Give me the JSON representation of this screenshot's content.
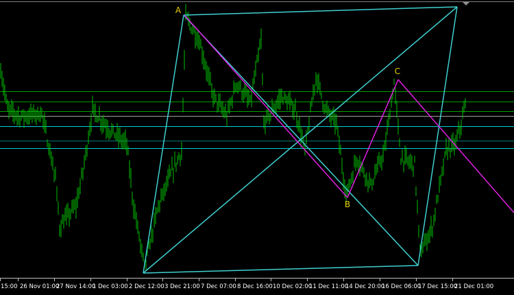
{
  "chart_data": {
    "type": "bar",
    "style": "ohlc-bars",
    "title": "",
    "x_tick_labels": [
      "15:00",
      "26 Nov 01:00",
      "27 Nov 14:00",
      "1 Dec 03:00",
      "2 Dec 12:00",
      "3 Dec 21:00",
      "7 Dec 07:00",
      "8 Dec 16:00",
      "10 Dec 02:00",
      "11 Dec 11:00",
      "14 Dec 20:00",
      "16 Dec 06:00",
      "17 Dec 15:00",
      "21 Dec 01:00"
    ],
    "price_path": [
      {
        "bar": 0,
        "level": 305
      },
      {
        "bar": 5,
        "level": 245
      },
      {
        "bar": 15,
        "level": 235
      },
      {
        "bar": 30,
        "level": 240
      },
      {
        "bar": 40,
        "level": 145
      },
      {
        "bar": 43,
        "level": 75
      },
      {
        "bar": 55,
        "level": 105
      },
      {
        "bar": 60,
        "level": 155
      },
      {
        "bar": 67,
        "level": 245
      },
      {
        "bar": 80,
        "level": 215
      },
      {
        "bar": 92,
        "level": 195
      },
      {
        "bar": 97,
        "level": 105
      },
      {
        "bar": 105,
        "level": 15
      },
      {
        "bar": 115,
        "level": 105
      },
      {
        "bar": 125,
        "level": 155
      },
      {
        "bar": 132,
        "level": 185
      },
      {
        "bar": 135,
        "level": 380
      },
      {
        "bar": 145,
        "level": 345
      },
      {
        "bar": 155,
        "level": 265
      },
      {
        "bar": 165,
        "level": 235
      },
      {
        "bar": 172,
        "level": 285
      },
      {
        "bar": 182,
        "level": 255
      },
      {
        "bar": 190,
        "level": 345
      },
      {
        "bar": 192,
        "level": 225
      },
      {
        "bar": 205,
        "level": 265
      },
      {
        "bar": 215,
        "level": 245
      },
      {
        "bar": 222,
        "level": 185
      },
      {
        "bar": 230,
        "level": 295
      },
      {
        "bar": 237,
        "level": 245
      },
      {
        "bar": 245,
        "level": 225
      },
      {
        "bar": 252,
        "level": 120
      },
      {
        "bar": 260,
        "level": 175
      },
      {
        "bar": 270,
        "level": 135
      },
      {
        "bar": 280,
        "level": 185
      },
      {
        "bar": 287,
        "level": 285
      },
      {
        "bar": 292,
        "level": 175
      },
      {
        "bar": 302,
        "level": 165
      },
      {
        "bar": 306,
        "level": 35
      },
      {
        "bar": 315,
        "level": 75
      },
      {
        "bar": 325,
        "level": 185
      },
      {
        "bar": 332,
        "level": 195
      },
      {
        "bar": 339,
        "level": 250
      }
    ],
    "bar_color": "#00c000",
    "horizontal_levels": [
      {
        "level": 272,
        "color": "#00a000"
      },
      {
        "level": 257,
        "color": "#00a000"
      },
      {
        "level": 243,
        "color": "#00a000"
      },
      {
        "level": 236,
        "color": "#a0a0a0"
      },
      {
        "level": 221,
        "color": "#00d0d0"
      },
      {
        "level": 200,
        "color": "#007878"
      },
      {
        "level": 189,
        "color": "#00d0d0"
      }
    ],
    "pattern_points": [
      {
        "label": "A",
        "bar": 134,
        "level": 383
      },
      {
        "label": "B",
        "bar": 253,
        "level": 117
      },
      {
        "label": "C",
        "bar": 290,
        "level": 289
      }
    ],
    "pattern_color": "#e020e0",
    "channel_color": "#40d0d0",
    "grid": false,
    "legend": "none"
  }
}
